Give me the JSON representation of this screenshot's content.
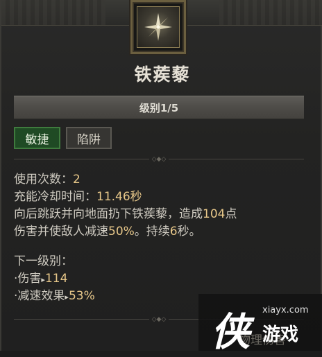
{
  "skill": {
    "icon": "caltrops-icon",
    "title": "铁蒺藜",
    "level_label": "级别1/5",
    "tags": [
      "敏捷",
      "陷阱"
    ]
  },
  "stats": {
    "charges_label": "使用次数：",
    "charges_value": "2",
    "cooldown_label": "充能冷却时间：",
    "cooldown_value": "11.46秒",
    "desc1_a": "向后跳跃并向地面扔下铁蒺藜，造成",
    "desc1_dmg": "104",
    "desc1_b": "点",
    "desc2_a": "伤害并使敌人减速",
    "desc2_slow": "50%",
    "desc2_b": "。持续",
    "desc2_dur": "6",
    "desc2_c": "秒。"
  },
  "next_level": {
    "header": "下一级别：",
    "items": [
      {
        "label": "伤害",
        "value": "114"
      },
      {
        "label": "减速效果",
        "value": "53%"
      }
    ]
  },
  "footer": {
    "category": "物理伤害"
  },
  "watermark": {
    "char": "侠",
    "url": "xiayx.com",
    "name": "游戏"
  },
  "colors": {
    "value_gold": "#e8c88a",
    "tag_active_bg": "#1f4a24"
  }
}
